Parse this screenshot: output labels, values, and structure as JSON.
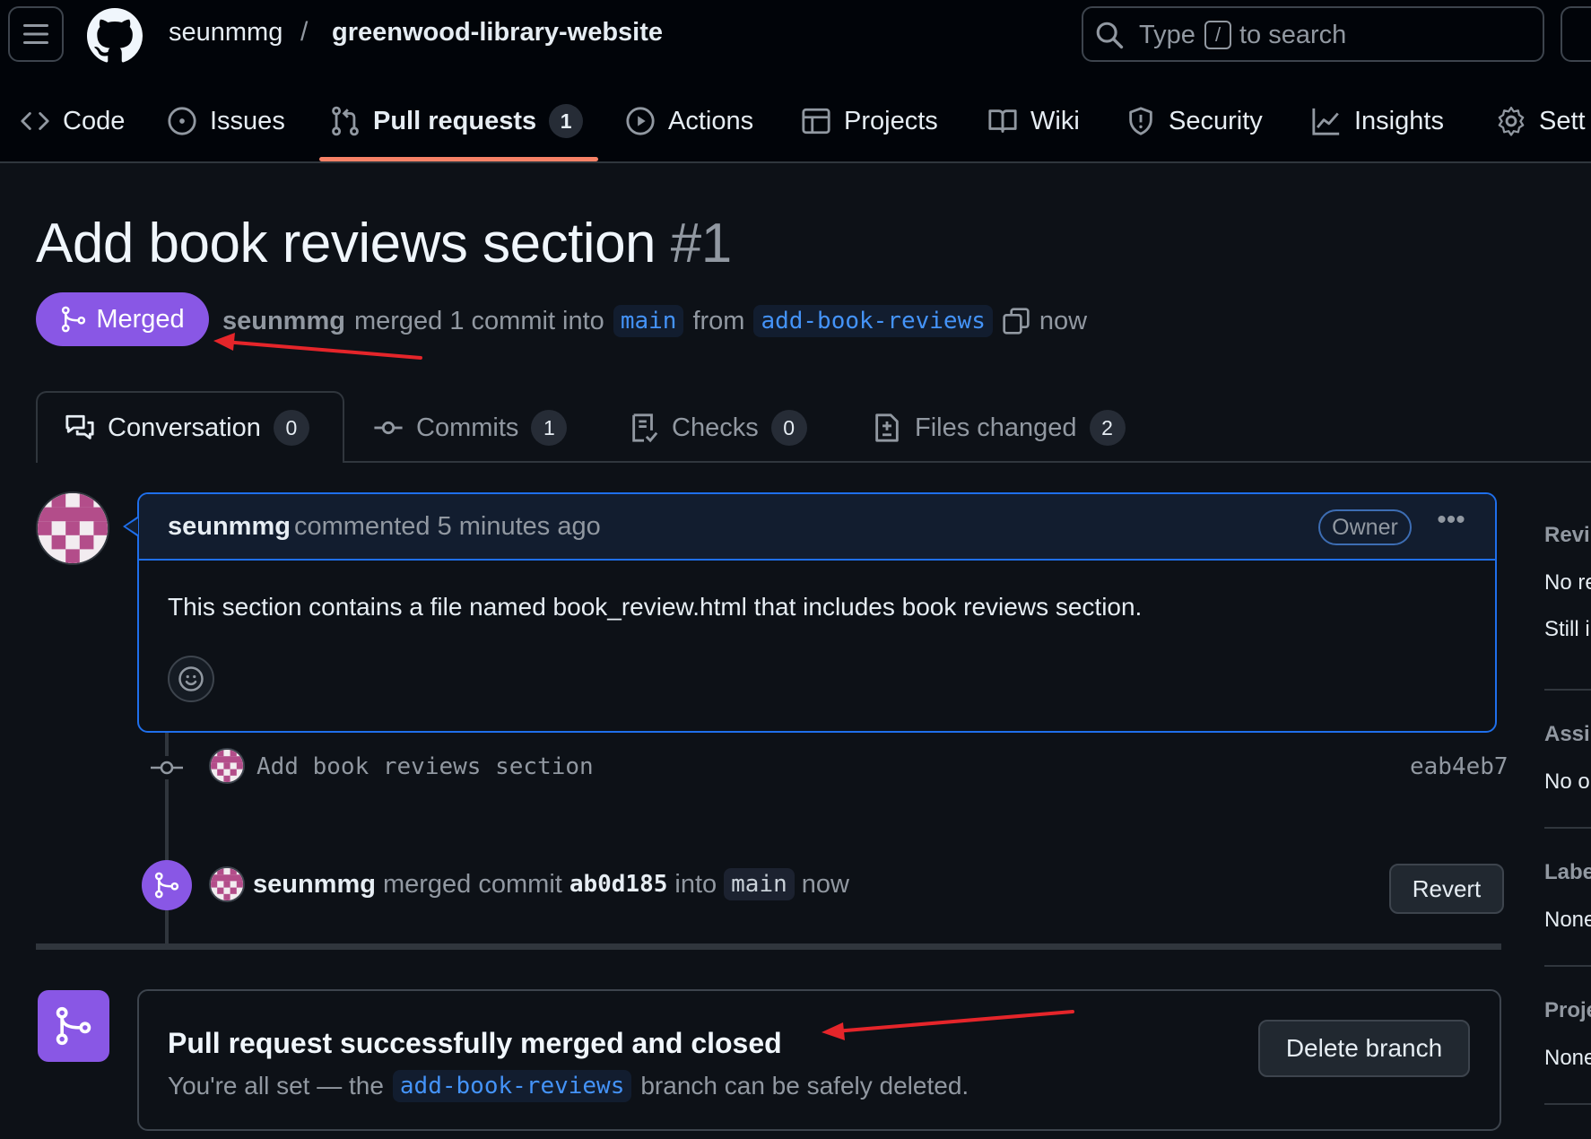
{
  "header": {
    "owner": "seunmmg",
    "separator": "/",
    "repo": "greenwood-library-website",
    "search_pre": "Type",
    "search_key": "/",
    "search_post": "to search"
  },
  "repo_tabs": [
    {
      "label": "Code",
      "icon": "code-icon"
    },
    {
      "label": "Issues",
      "icon": "issue-icon"
    },
    {
      "label": "Pull requests",
      "icon": "pull-request-icon",
      "count": "1",
      "selected": true
    },
    {
      "label": "Actions",
      "icon": "play-icon"
    },
    {
      "label": "Projects",
      "icon": "table-icon"
    },
    {
      "label": "Wiki",
      "icon": "book-icon"
    },
    {
      "label": "Security",
      "icon": "shield-icon"
    },
    {
      "label": "Insights",
      "icon": "graph-icon"
    },
    {
      "label": "Sett",
      "icon": "gear-icon"
    }
  ],
  "pr": {
    "title": "Add book reviews section",
    "number": "#1",
    "state": "Merged",
    "author": "seunmmg",
    "meta_verb": "merged 1 commit into",
    "base_branch": "main",
    "meta_from": "from",
    "head_branch": "add-book-reviews",
    "time": "now"
  },
  "pr_tabs": [
    {
      "label": "Conversation",
      "count": "0",
      "icon": "comment-discussion-icon"
    },
    {
      "label": "Commits",
      "count": "1",
      "icon": "git-commit-icon"
    },
    {
      "label": "Checks",
      "count": "0",
      "icon": "checklist-icon"
    },
    {
      "label": "Files changed",
      "count": "2",
      "icon": "file-diff-icon"
    }
  ],
  "comment": {
    "author": "seunmmg",
    "time": "commented 5 minutes ago",
    "badge": "Owner",
    "more": "•••",
    "body": "This section contains a file named book_review.html that includes book reviews section."
  },
  "timeline": {
    "commit_message": "Add book reviews section",
    "commit_sha": "eab4eb7",
    "merge_author": "seunmmg",
    "merge_text_1": "merged commit",
    "merge_sha": "ab0d185",
    "merge_text_2": "into",
    "merge_branch": "main",
    "merge_time": "now",
    "revert_label": "Revert"
  },
  "merged_box": {
    "heading": "Pull request successfully merged and closed",
    "sub_pre": "You're all set — the",
    "sub_branch": "add-book-reviews",
    "sub_post": "branch can be safely deleted.",
    "delete_label": "Delete branch"
  },
  "sidebar": [
    {
      "heading": "Revi",
      "lines": [
        "No re",
        "Still i"
      ]
    },
    {
      "heading": "Assi",
      "lines": [
        "No o"
      ]
    },
    {
      "heading": "Labe",
      "lines": [
        "None"
      ]
    },
    {
      "heading": "Proje",
      "lines": [
        "None"
      ]
    }
  ],
  "colors": {
    "merged_purple": "#8957e5",
    "link_blue": "#4493f8",
    "annotation_red": "#e5252a",
    "tab_underline": "#f78166"
  }
}
